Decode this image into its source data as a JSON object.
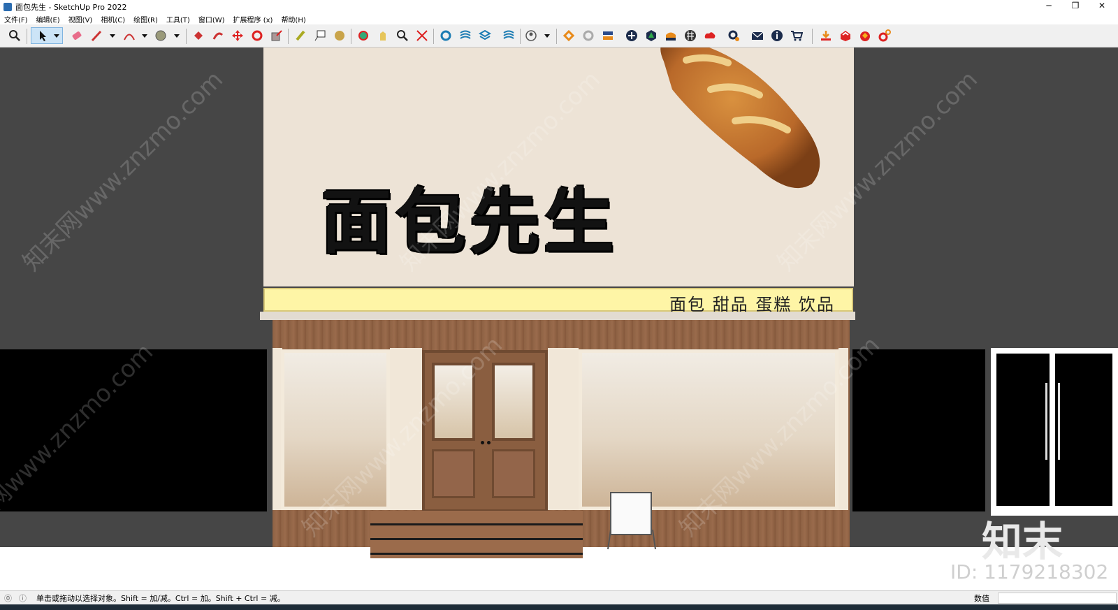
{
  "window": {
    "title": "面包先生 - SketchUp Pro 2022",
    "minimize_glyph": "─",
    "restore_glyph": "❐",
    "close_glyph": "✕"
  },
  "menu": [
    "文件(F)",
    "编辑(E)",
    "视图(V)",
    "相机(C)",
    "绘图(R)",
    "工具(T)",
    "窗口(W)",
    "扩展程序 (x)",
    "帮助(H)"
  ],
  "toolbar": {
    "icons": [
      "search-icon",
      "select-arrow-icon",
      "eraser-icon",
      "pencil-icon",
      "arc-icon",
      "tape-icon",
      "paint-bucket-icon",
      "push-pull-icon",
      "move-icon",
      "rotate-icon",
      "scale-icon",
      "walk-icon",
      "text-icon",
      "orbit-icon",
      "section-icon",
      "pan-icon",
      "zoom-icon",
      "zoom-extents-icon",
      "layers-icon",
      "styles-icon",
      "scenes-icon",
      "match-photo-icon",
      "account-icon",
      "warehouse-icon",
      "reload-icon",
      "swap-icon",
      "add-icon",
      "tree-icon",
      "sun-icon",
      "pattern-icon",
      "cloud-icon",
      "settings-icon",
      "mail-icon",
      "info-icon",
      "cart-icon",
      "import-icon",
      "export-icon",
      "render-icon",
      "gear-orange-icon"
    ]
  },
  "scene": {
    "brand_name": "面包先生",
    "band_text": "面包 甜品 蛋糕 饮品",
    "watermark_text": "知末网www.znzmo.com",
    "logo_text": "知末",
    "id_text": "ID: 1179218302"
  },
  "status": {
    "hint": "单击或拖动以选择对象。Shift = 加/减。Ctrl = 加。Shift + Ctrl = 减。",
    "measure_label": "数值"
  },
  "colors": {
    "sign_bg": "#ede3d6",
    "band_bg": "#fef5a6",
    "wood": "#8e6244",
    "viewport_bg": "#464646"
  }
}
